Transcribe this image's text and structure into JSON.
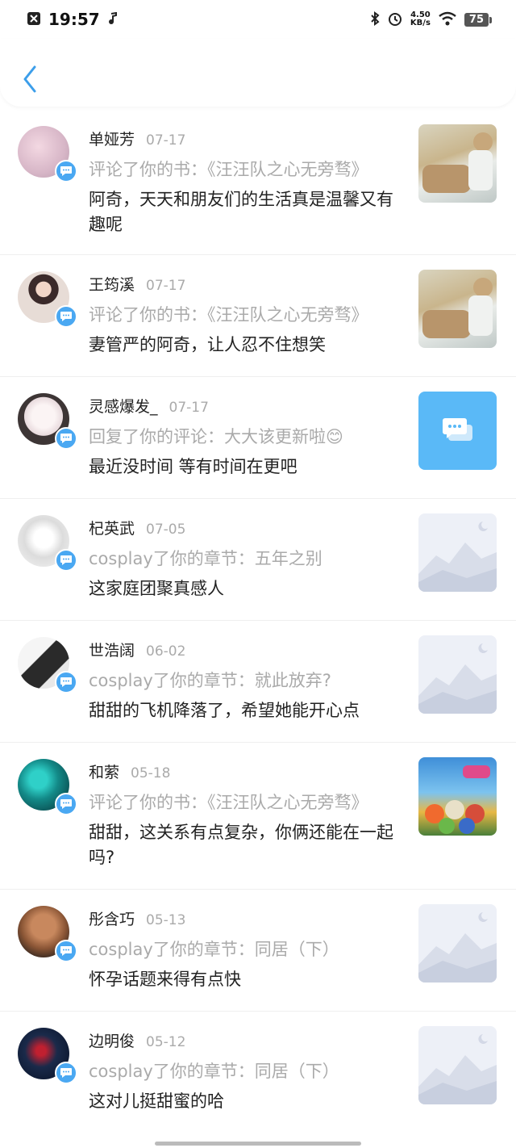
{
  "status": {
    "time": "19:57",
    "net_speed_value": "4.50",
    "net_speed_unit": "KB/s",
    "battery": "75"
  },
  "colors": {
    "accent": "#4aa8f2",
    "back_arrow": "#3c9eea",
    "message_thumb": "#5ab9f7"
  },
  "items": [
    {
      "name": "单娅芳",
      "date": "07-17",
      "action": "评论了你的书：《汪汪队之心无旁骛》",
      "content": "阿奇，天天和朋友们的生活真是温馨又有趣呢",
      "thumb": "book-cover-scene"
    },
    {
      "name": "王筠溪",
      "date": "07-17",
      "action": "评论了你的书：《汪汪队之心无旁骛》",
      "content": "妻管严的阿奇，让人忍不住想笑",
      "thumb": "book-cover-scene"
    },
    {
      "name": "灵感爆发_",
      "date": "07-17",
      "action": "回复了你的评论：大大该更新啦😊",
      "content": "最近没时间 等有时间在更吧",
      "thumb": "message-icon"
    },
    {
      "name": "杞英武",
      "date": "07-05",
      "action": "cosplay了你的章节：五年之别",
      "content": "这家庭团聚真感人",
      "thumb": "placeholder-mountain"
    },
    {
      "name": "世浩阔",
      "date": "06-02",
      "action": "cosplay了你的章节：就此放弃?",
      "content": "甜甜的飞机降落了，希望她能开心点",
      "thumb": "placeholder-mountain"
    },
    {
      "name": "和萦",
      "date": "05-18",
      "action": "评论了你的书：《汪汪队之心无旁骛》",
      "content": "甜甜，这关系有点复杂，你俩还能在一起吗?",
      "thumb": "paw-patrol-cover"
    },
    {
      "name": "彤含巧",
      "date": "05-13",
      "action": "cosplay了你的章节：同居（下）",
      "content": "怀孕话题来得有点快",
      "thumb": "placeholder-mountain"
    },
    {
      "name": "边明俊",
      "date": "05-12",
      "action": "cosplay了你的章节：同居（下）",
      "content": "这对儿挺甜蜜的哈",
      "thumb": "placeholder-mountain"
    }
  ]
}
